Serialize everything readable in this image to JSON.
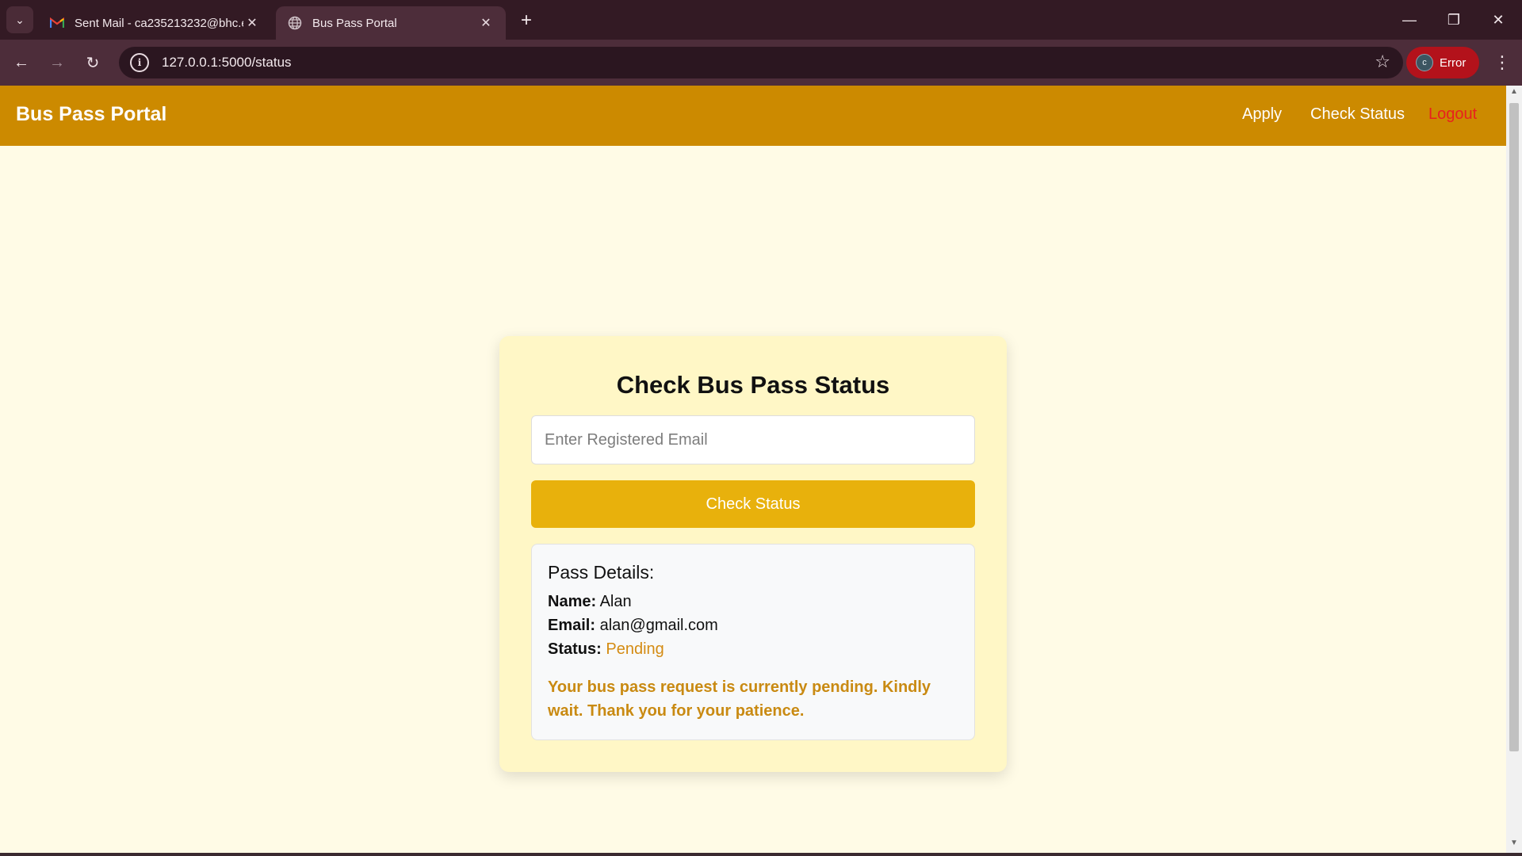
{
  "browser": {
    "tabs": [
      {
        "title": "Sent Mail - ca235213232@bhc.e",
        "icon": "gmail-icon",
        "active": false
      },
      {
        "title": "Bus Pass Portal",
        "icon": "globe-icon",
        "active": true
      }
    ],
    "new_tab_label": "+",
    "address": "127.0.0.1:5000/status",
    "profile": {
      "initial": "c",
      "label": "Error"
    },
    "colors": {
      "frame": "#331a24",
      "toolbar": "#4d2d3a",
      "profile_error": "#b3121b"
    }
  },
  "site": {
    "brand": "Bus Pass Portal",
    "nav": {
      "apply": "Apply",
      "check_status": "Check Status",
      "logout": "Logout"
    },
    "colors": {
      "navbar": "#cc8a00",
      "background": "#fffbe6",
      "card": "#fff7c6",
      "button": "#e8b10c",
      "pending": "#d48b12",
      "logout": "#e8201e"
    }
  },
  "status_card": {
    "title": "Check Bus Pass Status",
    "email_placeholder": "Enter Registered Email",
    "email_value": "",
    "button_label": "Check Status",
    "details": {
      "heading": "Pass Details:",
      "name_label": "Name:",
      "name_value": "Alan",
      "email_label": "Email:",
      "email_value": "alan@gmail.com",
      "status_label": "Status:",
      "status_value": "Pending",
      "message": "Your bus pass request is currently pending. Kindly wait. Thank you for your patience."
    }
  }
}
